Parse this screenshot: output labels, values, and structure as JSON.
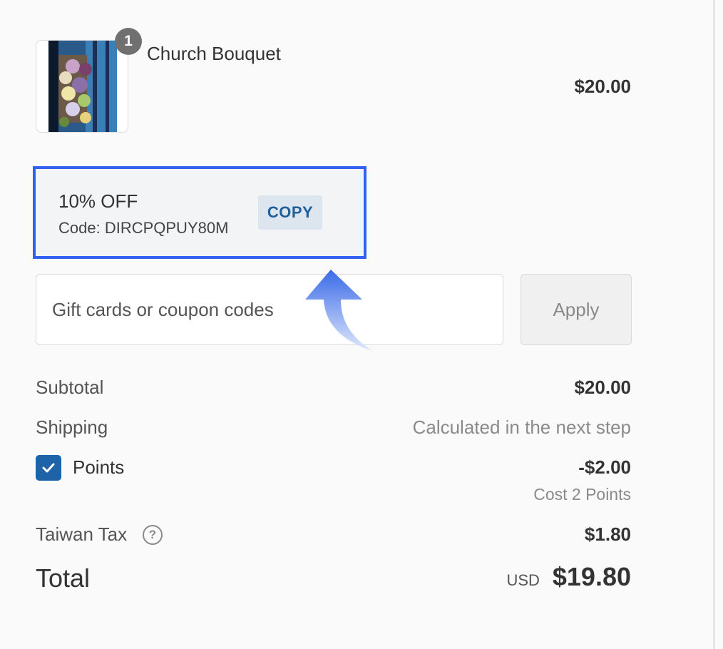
{
  "product": {
    "name": "Church Bouquet",
    "price": "$20.00",
    "quantity": "1"
  },
  "coupon": {
    "title": "10% OFF",
    "code_text": "Code: DIRCPQPUY80M",
    "copy_label": "COPY"
  },
  "discount": {
    "placeholder": "Gift cards or coupon codes",
    "apply_label": "Apply"
  },
  "summary": {
    "subtotal_label": "Subtotal",
    "subtotal_value": "$20.00",
    "shipping_label": "Shipping",
    "shipping_value": "Calculated in the next step",
    "points_label": "Points",
    "points_value": "-$2.00",
    "points_cost": "Cost 2 Points",
    "points_checked": true,
    "tax_label": "Taiwan Tax",
    "tax_value": "$1.80",
    "total_label": "Total",
    "currency": "USD",
    "total_value": "$19.80"
  },
  "colors": {
    "highlight_border": "#3460f2",
    "checkbox_fill": "#1e63a8",
    "copy_text": "#1f5f9a"
  }
}
